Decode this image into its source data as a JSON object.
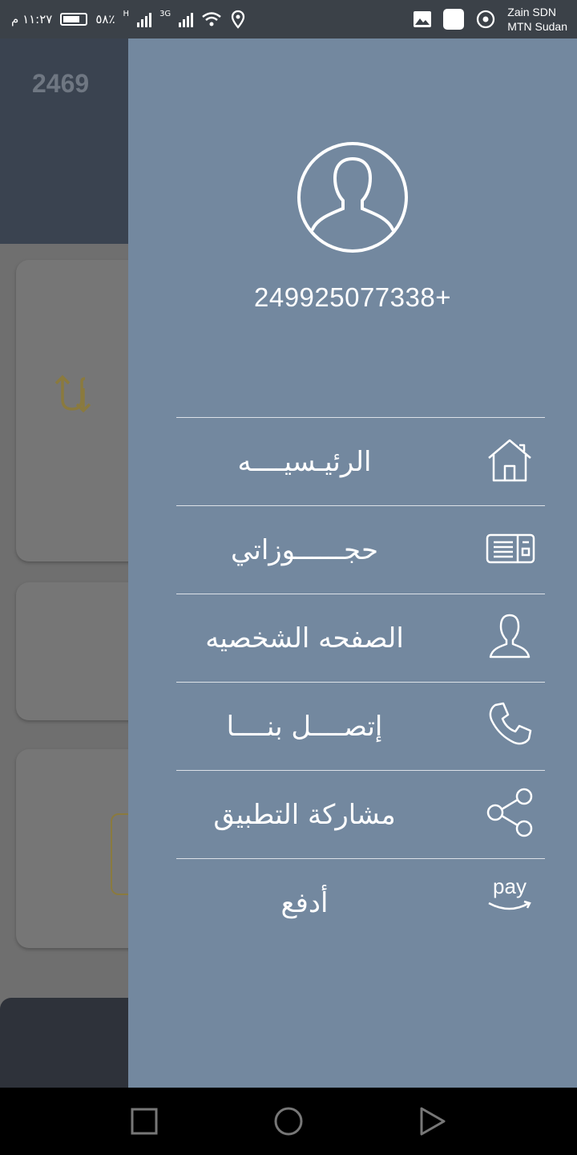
{
  "status_bar": {
    "time": "١١:٢٧ م",
    "battery_text": "٥٨٪",
    "net_h": "H",
    "net_3g": "3G",
    "carrier_1": "Zain SDN",
    "carrier_2": "MTN Sudan"
  },
  "background": {
    "balance_number": "2469"
  },
  "drawer": {
    "phone_number": "249925077338+",
    "menu": [
      {
        "label": "الرئيـسيــــه",
        "icon": "home-icon"
      },
      {
        "label": "حجــــــوزاتي",
        "icon": "ticket-icon"
      },
      {
        "label": "الصفحه الشخصيه",
        "icon": "person-icon"
      },
      {
        "label": "إتصــــل بنــــا",
        "icon": "phone-icon"
      },
      {
        "label": "مشاركة التطبيق",
        "icon": "share-icon"
      },
      {
        "label": "أدفع",
        "icon": "pay-icon"
      }
    ],
    "pay_icon_text": "pay"
  },
  "nav_bar": {
    "buttons": [
      "recents-button",
      "home-button",
      "back-button"
    ]
  },
  "colors": {
    "drawer_bg": "#73889f",
    "status_bar_bg": "#3b4148",
    "header_bg": "#3a4350",
    "scrim": "#6f6f6f"
  }
}
